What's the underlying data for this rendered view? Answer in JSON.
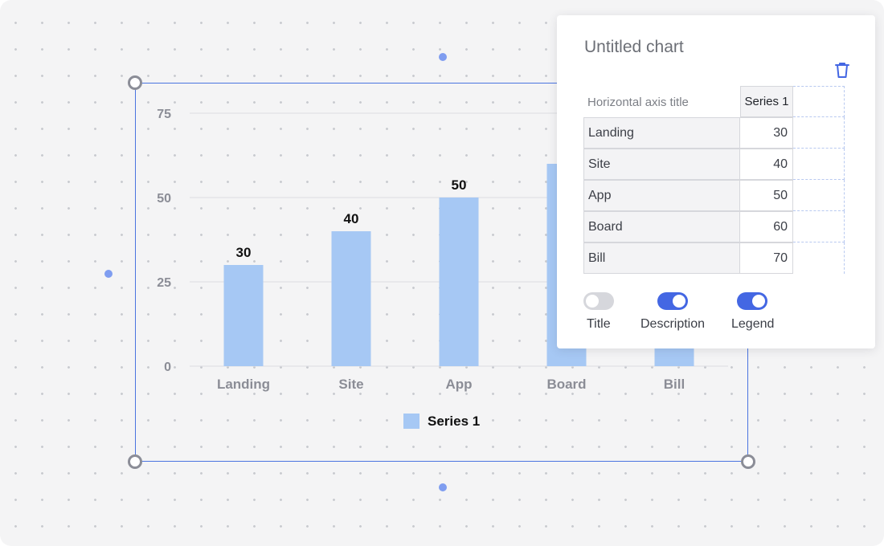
{
  "editor": {
    "title": "Untitled chart",
    "table_header_label": "Horizontal axis title",
    "series_header": "Series 1",
    "rows": [
      {
        "label": "Landing",
        "value": "30"
      },
      {
        "label": "Site",
        "value": "40"
      },
      {
        "label": "App",
        "value": "50"
      },
      {
        "label": "Board",
        "value": "60"
      },
      {
        "label": "Bill",
        "value": "70"
      }
    ],
    "toggles": [
      {
        "label": "Title",
        "on": false
      },
      {
        "label": "Description",
        "on": true
      },
      {
        "label": "Legend",
        "on": true
      }
    ],
    "delete_icon": "trash-icon"
  },
  "colors": {
    "accent": "#4467e3",
    "selection": "#4a74e0",
    "bar": "#a6c8f4"
  },
  "chart_data": {
    "type": "bar",
    "categories": [
      "Landing",
      "Site",
      "App",
      "Board",
      "Bill"
    ],
    "series": [
      {
        "name": "Series 1",
        "values": [
          30,
          40,
          50,
          60,
          70
        ]
      }
    ],
    "ylim": [
      0,
      75
    ],
    "yticks": [
      0,
      25,
      50,
      75
    ],
    "data_labels": true,
    "grid": true,
    "legend": "bottom",
    "title": "",
    "xlabel": "",
    "ylabel": ""
  }
}
